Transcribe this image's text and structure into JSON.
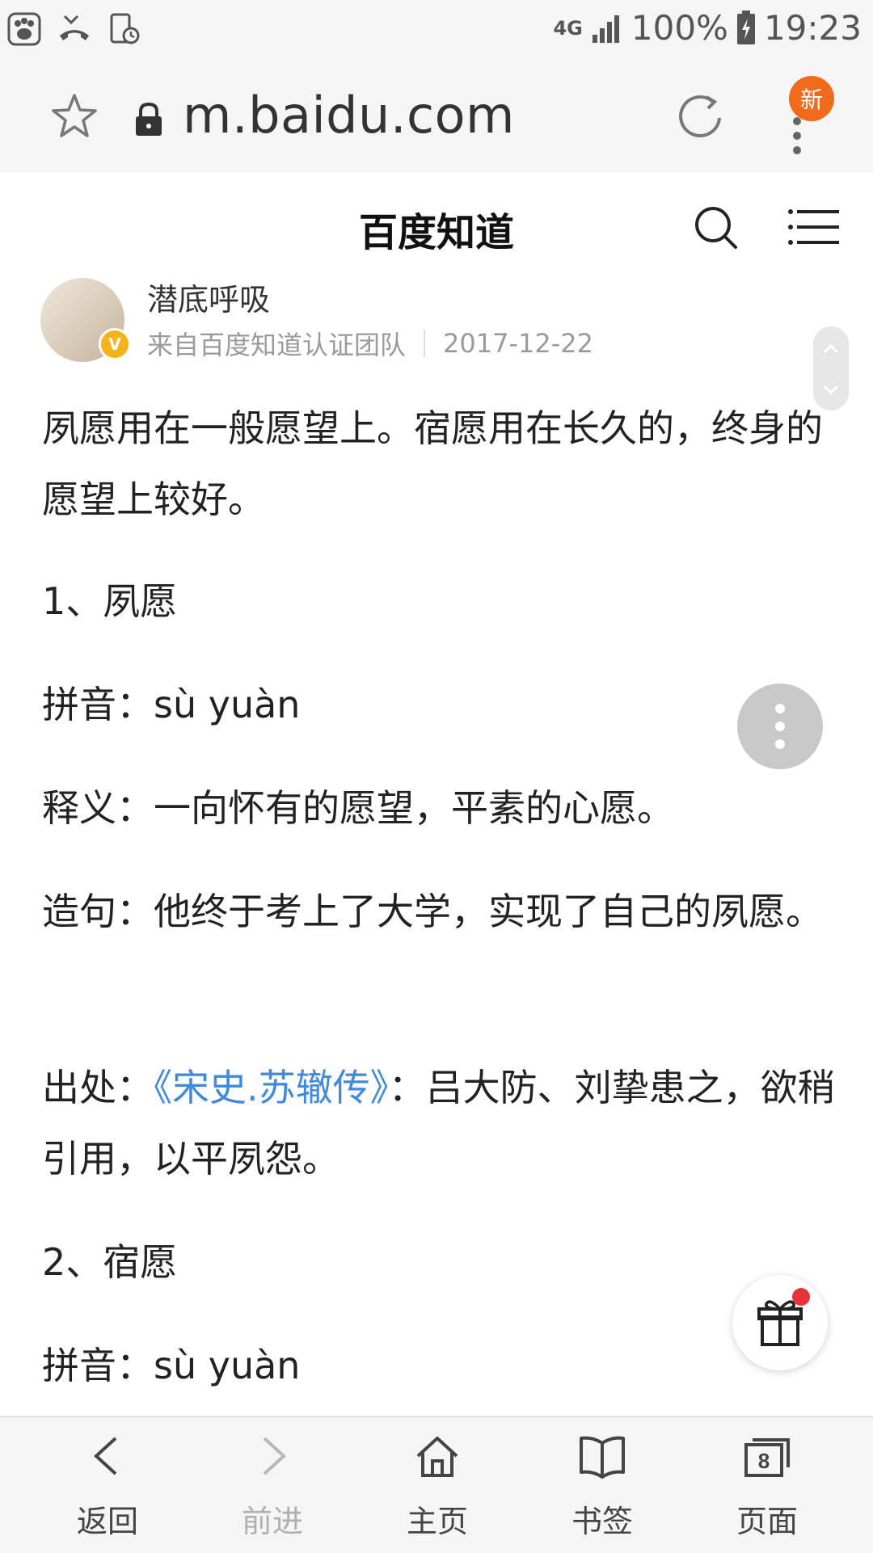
{
  "status_bar": {
    "network": "4G",
    "battery": "100%",
    "time": "19:23"
  },
  "browser": {
    "url": "m.baidu.com",
    "menu_badge": "新"
  },
  "site": {
    "title": "百度知道"
  },
  "answer": {
    "author": "潜底呼吸",
    "verified_badge": "V",
    "source": "来自百度知道认证团队",
    "date": "2017-12-22",
    "intro": "夙愿用在一般愿望上。宿愿用在长久的，终身的愿望上较好。",
    "item1_title": "1、夙愿",
    "item1_pinyin": "拼音：sù yuàn",
    "item1_meaning": "释义：一向怀有的愿望，平素的心愿。",
    "item1_example": "造句：他终于考上了大学，实现了自己的夙愿。",
    "item1_source_label": "出处：",
    "item1_source_link": "《宋史.苏辙传》",
    "item1_source_text": "：吕大防、刘挚患之，欲稍引用，以平夙怨。",
    "item2_title": "2、宿愿",
    "item2_pinyin": "拼音：sù yuàn"
  },
  "bottom_nav": {
    "back": "返回",
    "forward": "前进",
    "home": "主页",
    "bookmarks": "书签",
    "tabs": "页面",
    "tab_count": "8"
  },
  "colors": {
    "link": "#3f89de",
    "badge": "#f26a1b",
    "verified": "#f6b21a"
  }
}
